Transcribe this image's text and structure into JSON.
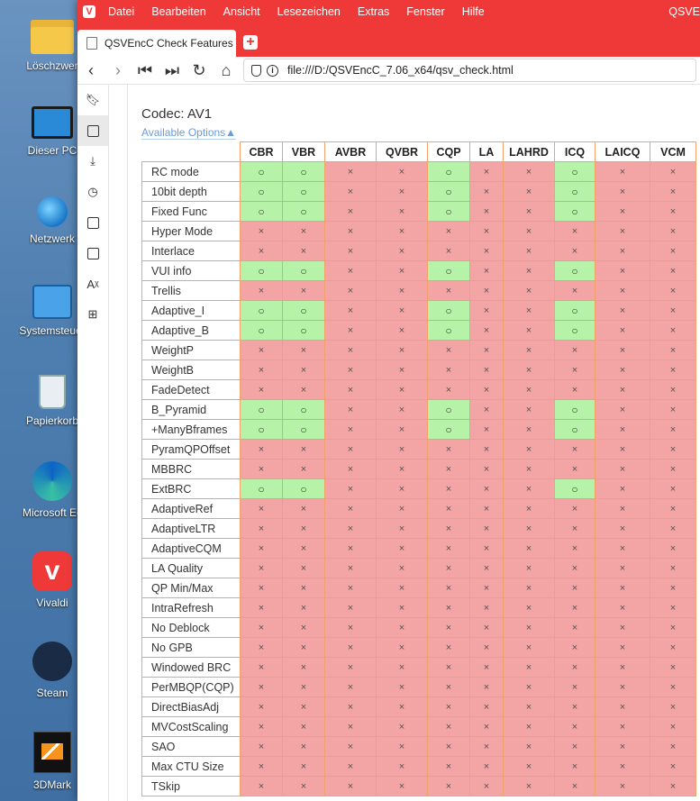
{
  "desktop": {
    "icons": [
      {
        "label": "Löschzwer",
        "icon": "folder-icon"
      },
      {
        "label": "Dieser PC",
        "icon": "computer-icon"
      },
      {
        "label": "Netzwerk",
        "icon": "network-icon"
      },
      {
        "label": "Systemsteuer",
        "icon": "control-panel-icon"
      },
      {
        "label": "Papierkorb",
        "icon": "recycle-bin-icon"
      },
      {
        "label": "Microsoft Ec",
        "icon": "edge-icon"
      },
      {
        "label": "Vivaldi",
        "icon": "vivaldi-icon"
      },
      {
        "label": "Steam",
        "icon": "steam-icon"
      },
      {
        "label": "3DMark",
        "icon": "3dmark-icon"
      }
    ]
  },
  "browser": {
    "accent_color": "#ef3939",
    "menu": [
      "Datei",
      "Bearbeiten",
      "Ansicht",
      "Lesezeichen",
      "Extras",
      "Fenster",
      "Hilfe"
    ],
    "window_title": "QSVE",
    "tab_title": "QSVEncC Check Features",
    "new_tab_label": "+",
    "url": "file:///D:/QSVEncC_7.06_x64/qsv_check.html"
  },
  "page": {
    "codec_title": "Codec: AV1",
    "available_options_link": "Available Options▲",
    "yes_symbol": "○",
    "no_symbol": "×",
    "yes_color": "#b7f2a9",
    "no_color": "#f3a4a4",
    "columns": [
      "CBR",
      "VBR",
      "AVBR",
      "QVBR",
      "CQP",
      "LA",
      "LAHRD",
      "ICQ",
      "LAICQ",
      "VCM"
    ],
    "rows": [
      {
        "label": "RC mode",
        "support": [
          1,
          1,
          0,
          0,
          1,
          0,
          0,
          1,
          0,
          0
        ]
      },
      {
        "label": "10bit depth",
        "support": [
          1,
          1,
          0,
          0,
          1,
          0,
          0,
          1,
          0,
          0
        ]
      },
      {
        "label": "Fixed Func",
        "support": [
          1,
          1,
          0,
          0,
          1,
          0,
          0,
          1,
          0,
          0
        ]
      },
      {
        "label": "Hyper Mode",
        "support": [
          0,
          0,
          0,
          0,
          0,
          0,
          0,
          0,
          0,
          0
        ]
      },
      {
        "label": "Interlace",
        "support": [
          0,
          0,
          0,
          0,
          0,
          0,
          0,
          0,
          0,
          0
        ]
      },
      {
        "label": "VUI info",
        "support": [
          1,
          1,
          0,
          0,
          1,
          0,
          0,
          1,
          0,
          0
        ]
      },
      {
        "label": "Trellis",
        "support": [
          0,
          0,
          0,
          0,
          0,
          0,
          0,
          0,
          0,
          0
        ]
      },
      {
        "label": "Adaptive_I",
        "support": [
          1,
          1,
          0,
          0,
          1,
          0,
          0,
          1,
          0,
          0
        ]
      },
      {
        "label": "Adaptive_B",
        "support": [
          1,
          1,
          0,
          0,
          1,
          0,
          0,
          1,
          0,
          0
        ]
      },
      {
        "label": "WeightP",
        "support": [
          0,
          0,
          0,
          0,
          0,
          0,
          0,
          0,
          0,
          0
        ]
      },
      {
        "label": "WeightB",
        "support": [
          0,
          0,
          0,
          0,
          0,
          0,
          0,
          0,
          0,
          0
        ]
      },
      {
        "label": "FadeDetect",
        "support": [
          0,
          0,
          0,
          0,
          0,
          0,
          0,
          0,
          0,
          0
        ]
      },
      {
        "label": "B_Pyramid",
        "support": [
          1,
          1,
          0,
          0,
          1,
          0,
          0,
          1,
          0,
          0
        ]
      },
      {
        "label": "+ManyBframes",
        "support": [
          1,
          1,
          0,
          0,
          1,
          0,
          0,
          1,
          0,
          0
        ]
      },
      {
        "label": "PyramQPOffset",
        "support": [
          0,
          0,
          0,
          0,
          0,
          0,
          0,
          0,
          0,
          0
        ]
      },
      {
        "label": "MBBRC",
        "support": [
          0,
          0,
          0,
          0,
          0,
          0,
          0,
          0,
          0,
          0
        ]
      },
      {
        "label": "ExtBRC",
        "support": [
          1,
          1,
          0,
          0,
          0,
          0,
          0,
          1,
          0,
          0
        ]
      },
      {
        "label": "AdaptiveRef",
        "support": [
          0,
          0,
          0,
          0,
          0,
          0,
          0,
          0,
          0,
          0
        ]
      },
      {
        "label": "AdaptiveLTR",
        "support": [
          0,
          0,
          0,
          0,
          0,
          0,
          0,
          0,
          0,
          0
        ]
      },
      {
        "label": "AdaptiveCQM",
        "support": [
          0,
          0,
          0,
          0,
          0,
          0,
          0,
          0,
          0,
          0
        ]
      },
      {
        "label": "LA Quality",
        "support": [
          0,
          0,
          0,
          0,
          0,
          0,
          0,
          0,
          0,
          0
        ]
      },
      {
        "label": "QP Min/Max",
        "support": [
          0,
          0,
          0,
          0,
          0,
          0,
          0,
          0,
          0,
          0
        ]
      },
      {
        "label": "IntraRefresh",
        "support": [
          0,
          0,
          0,
          0,
          0,
          0,
          0,
          0,
          0,
          0
        ]
      },
      {
        "label": "No Deblock",
        "support": [
          0,
          0,
          0,
          0,
          0,
          0,
          0,
          0,
          0,
          0
        ]
      },
      {
        "label": "No GPB",
        "support": [
          0,
          0,
          0,
          0,
          0,
          0,
          0,
          0,
          0,
          0
        ]
      },
      {
        "label": "Windowed BRC",
        "support": [
          0,
          0,
          0,
          0,
          0,
          0,
          0,
          0,
          0,
          0
        ]
      },
      {
        "label": "PerMBQP(CQP)",
        "support": [
          0,
          0,
          0,
          0,
          0,
          0,
          0,
          0,
          0,
          0
        ]
      },
      {
        "label": "DirectBiasAdj",
        "support": [
          0,
          0,
          0,
          0,
          0,
          0,
          0,
          0,
          0,
          0
        ]
      },
      {
        "label": "MVCostScaling",
        "support": [
          0,
          0,
          0,
          0,
          0,
          0,
          0,
          0,
          0,
          0
        ]
      },
      {
        "label": "SAO",
        "support": [
          0,
          0,
          0,
          0,
          0,
          0,
          0,
          0,
          0,
          0
        ]
      },
      {
        "label": "Max CTU Size",
        "support": [
          0,
          0,
          0,
          0,
          0,
          0,
          0,
          0,
          0,
          0
        ]
      },
      {
        "label": "TSkip",
        "support": [
          0,
          0,
          0,
          0,
          0,
          0,
          0,
          0,
          0,
          0
        ]
      }
    ]
  }
}
